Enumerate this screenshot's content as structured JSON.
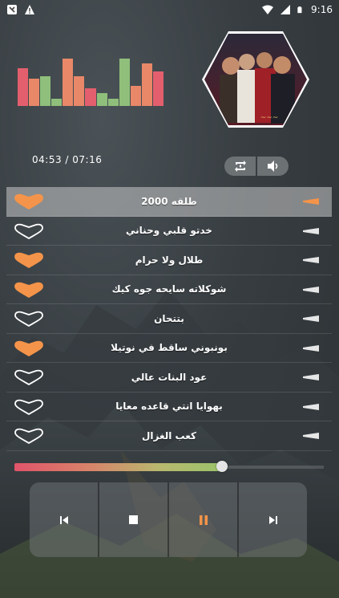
{
  "statusbar": {
    "time": "9:16"
  },
  "equalizer": {
    "levels": [
      0.75,
      0.55,
      0.6,
      0.15,
      0.95,
      0.6,
      0.35,
      0.25,
      0.15,
      0.95,
      0.4,
      0.85,
      0.7
    ],
    "colors": [
      "#e45f6e",
      "#e88869",
      "#8fbf7b",
      "#8fbf7b",
      "#e88869",
      "#e88869",
      "#e45f6e",
      "#8fbf7b",
      "#8fbf7b",
      "#8fbf7b",
      "#e88869",
      "#e88869",
      "#e45f6e"
    ]
  },
  "player": {
    "time_display": "04:53 / 07:16",
    "progress": 0.65
  },
  "colors": {
    "accent_heart": "#f4944a",
    "progress_start": "#e0546a",
    "progress_end": "#9bc36a"
  },
  "tracks": [
    {
      "title": "2000 طلقه",
      "favorite": true,
      "active": true
    },
    {
      "title": "خدتو قلبي وحناني",
      "favorite": false,
      "active": false
    },
    {
      "title": "طلال ولا حرام",
      "favorite": true,
      "active": false
    },
    {
      "title": "شوكلاته سايحه جوه كيك",
      "favorite": true,
      "active": false
    },
    {
      "title": "بتتحان",
      "favorite": false,
      "active": false
    },
    {
      "title": "بونبوني ساقط في نوتيلا",
      "favorite": true,
      "active": false
    },
    {
      "title": "عود البنات عالي",
      "favorite": false,
      "active": false
    },
    {
      "title": "بهوايا انتي قاعده معايا",
      "favorite": false,
      "active": false
    },
    {
      "title": "كعب الغزال",
      "favorite": false,
      "active": false
    }
  ],
  "icons": {
    "repeat": "repeat-icon",
    "volume": "volume-icon",
    "previous": "previous-icon",
    "stop": "stop-icon",
    "pause": "pause-icon",
    "next": "next-icon"
  }
}
